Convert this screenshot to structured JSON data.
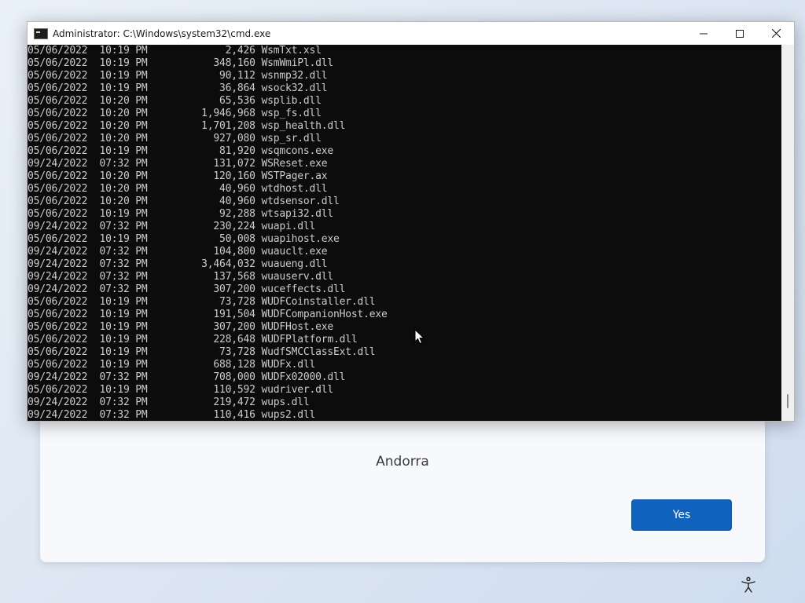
{
  "cmd": {
    "title": "Administrator: C:\\Windows\\system32\\cmd.exe",
    "icons": {
      "app": "cmd-icon",
      "minimize": "minimize-icon",
      "maximize": "maximize-icon",
      "close": "close-icon"
    },
    "lines": [
      "05/06/2022  10:19 PM             2,426 WsmTxt.xsl",
      "05/06/2022  10:19 PM           348,160 WsmWmiPl.dll",
      "05/06/2022  10:19 PM            90,112 wsnmp32.dll",
      "05/06/2022  10:19 PM            36,864 wsock32.dll",
      "05/06/2022  10:20 PM            65,536 wsplib.dll",
      "05/06/2022  10:20 PM         1,946,968 wsp_fs.dll",
      "05/06/2022  10:20 PM         1,701,208 wsp_health.dll",
      "05/06/2022  10:20 PM           927,080 wsp_sr.dll",
      "05/06/2022  10:19 PM            81,920 wsqmcons.exe",
      "09/24/2022  07:32 PM           131,072 WSReset.exe",
      "05/06/2022  10:20 PM           120,160 WSTPager.ax",
      "05/06/2022  10:20 PM            40,960 wtdhost.dll",
      "05/06/2022  10:20 PM            40,960 wtdsensor.dll",
      "05/06/2022  10:19 PM            92,288 wtsapi32.dll",
      "09/24/2022  07:32 PM           230,224 wuapi.dll",
      "05/06/2022  10:19 PM            50,008 wuapihost.exe",
      "09/24/2022  07:32 PM           104,800 wuauclt.exe",
      "09/24/2022  07:32 PM         3,464,032 wuaueng.dll",
      "09/24/2022  07:32 PM           137,568 wuauserv.dll",
      "09/24/2022  07:32 PM           307,200 wuceffects.dll",
      "05/06/2022  10:19 PM            73,728 WUDFCoinstaller.dll",
      "05/06/2022  10:19 PM           191,504 WUDFCompanionHost.exe",
      "05/06/2022  10:19 PM           307,200 WUDFHost.exe",
      "05/06/2022  10:19 PM           228,648 WUDFPlatform.dll",
      "05/06/2022  10:19 PM            73,728 WudfSMCClassExt.dll",
      "05/06/2022  10:19 PM           688,128 WUDFx.dll",
      "09/24/2022  07:32 PM           708,000 WUDFx02000.dll",
      "05/06/2022  10:19 PM           110,592 wudriver.dll",
      "09/24/2022  07:32 PM           219,472 wups.dll",
      "09/24/2022  07:32 PM           110,416 wups2.dll"
    ],
    "colors": {
      "background": "#0c0c0c",
      "text": "#cccccc"
    }
  },
  "oobe": {
    "country": "Andorra",
    "yes_label": "Yes",
    "accent": "#0f63be",
    "accessibility_icon": "accessibility-icon"
  }
}
